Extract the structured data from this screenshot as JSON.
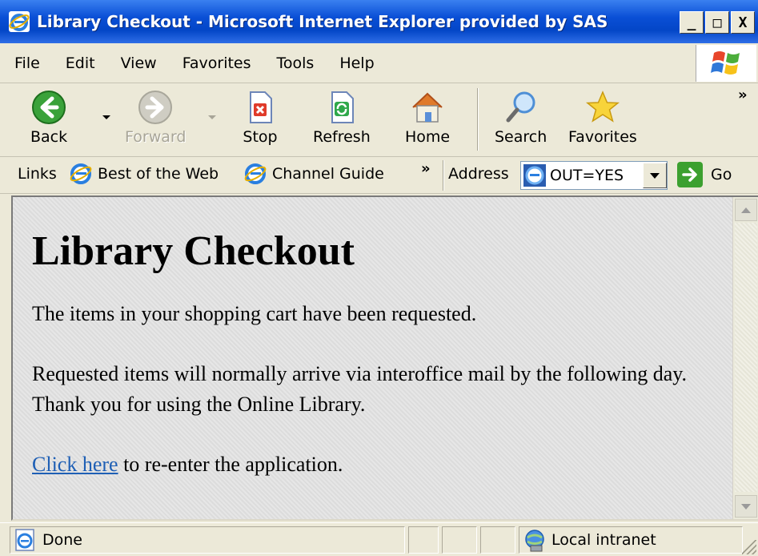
{
  "window": {
    "title": "Library Checkout - Microsoft Internet Explorer provided by SAS",
    "controls": [
      "_",
      "□",
      "X"
    ]
  },
  "menubar": {
    "items": [
      "File",
      "Edit",
      "View",
      "Favorites",
      "Tools",
      "Help"
    ]
  },
  "toolbar": {
    "back_label": "Back",
    "forward_label": "Forward",
    "stop_label": "Stop",
    "refresh_label": "Refresh",
    "home_label": "Home",
    "search_label": "Search",
    "favorites_label": "Favorites",
    "overflow": "»"
  },
  "linksbar": {
    "label": "Links",
    "items": [
      "Best of the Web",
      "Channel Guide"
    ],
    "overflow": "»"
  },
  "addressbar": {
    "label": "Address",
    "value": "OUT=YES",
    "go_label": "Go"
  },
  "page": {
    "heading": "Library Checkout",
    "para1": "The items in your shopping cart have been requested.",
    "para2": "Requested items will normally arrive via interoffice mail by the following day. Thank you for using the Online Library.",
    "link_text": "Click here",
    "link_suffix": " to re-enter the application."
  },
  "statusbar": {
    "status": "Done",
    "zone": "Local intranet"
  },
  "colors": {
    "titlebar": "#0a4fd6",
    "chrome": "#ece9d8",
    "link": "#1e5fb5"
  }
}
